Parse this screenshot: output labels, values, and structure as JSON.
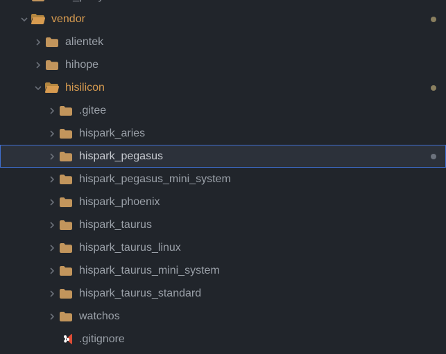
{
  "tree": {
    "third_party": "third_party",
    "vendor": "vendor",
    "alientek": "alientek",
    "hihope": "hihope",
    "hisilicon": "hisilicon",
    "gitee": ".gitee",
    "hispark_aries": "hispark_aries",
    "hispark_pegasus": "hispark_pegasus",
    "hispark_pegasus_mini_system": "hispark_pegasus_mini_system",
    "hispark_phoenix": "hispark_phoenix",
    "hispark_taurus": "hispark_taurus",
    "hispark_taurus_linux": "hispark_taurus_linux",
    "hispark_taurus_mini_system": "hispark_taurus_mini_system",
    "hispark_taurus_standard": "hispark_taurus_standard",
    "watchos": "watchos",
    "gitignore": ".gitignore"
  }
}
